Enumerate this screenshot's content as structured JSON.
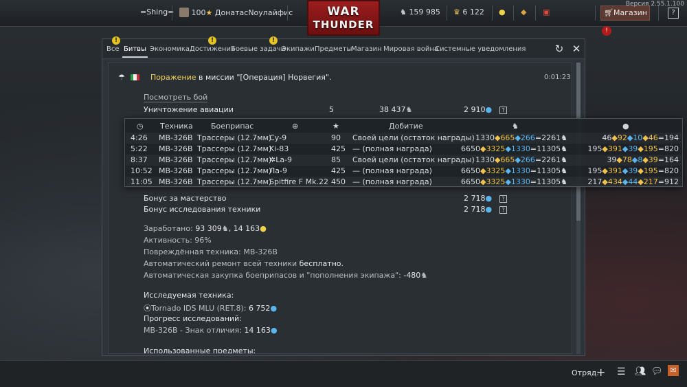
{
  "topbar": {
    "nickname": "=Shing=",
    "level": "100",
    "title": "ДонатасNоулайфис",
    "logo_line1": "WAR",
    "logo_line2": "THUNDER",
    "silver_lions": "159 985",
    "golden_eagles": "6 122",
    "shop_label": "Магазин",
    "version": "Версия 2.55.1.100",
    "help": "?"
  },
  "tabs": [
    "Все",
    "Битвы",
    "Экономика",
    "Достижения",
    "Боевые задачи",
    "Экипажи",
    "Предметы",
    "Магазин",
    "Мировая война",
    "Системные уведомления"
  ],
  "active_tab": "Битвы",
  "report": {
    "result": "Поражение",
    "mission_prefix": " в миссии \"[Операция] Норвегия\".",
    "time": "0:01:23",
    "view_battle": "Посмотреть бой",
    "aircraft_destroyed_label": "Уничтожение авиации",
    "aircraft_destroyed_count": "5",
    "aircraft_destroyed_sl": "38 437",
    "aircraft_destroyed_rp": "2 910",
    "mastery_label": "Бонус за мастерство",
    "mastery_rp": "2 718",
    "research_bonus_label": "Бонус исследования техники",
    "research_bonus_rp": "2 718",
    "earned_label": "Заработано:",
    "earned_sl": "93 309",
    "earned_rp": "14 163",
    "activity": "Активность: 96%",
    "damaged": "Повреждённая техника: MB-326B",
    "repair_prefix": "Автоматический ремонт всей техники ",
    "repair_value": "бесплатно.",
    "ammo_label": "Автоматическая закупка боеприпасов и \"пополнения экипажа\":",
    "ammo_value": "-480",
    "researched_label": "Исследуемая техника:",
    "researched_vehicle": "Tornado IDS MLU (RET.8):",
    "researched_value": "6 752",
    "progress_label": "Прогресс исследований:",
    "progress_vehicle": "MB-326B - Знак отличия:",
    "progress_value": "14 163",
    "used_items": "Использованные предметы:"
  },
  "kills_table": {
    "headers": [
      "Техника",
      "Боеприпас",
      "Добитие"
    ],
    "rows": [
      {
        "time": "4:26",
        "vehicle": "MB-326B",
        "ammo": "Трассеры (12.7мм)",
        "target": "Су-9",
        "points": "90",
        "finish": "Своей цели (остаток награды)",
        "sl_base": "1330",
        "sl_a": "665",
        "sl_b": "266",
        "sl_total": "=2261",
        "rp_base": "46",
        "rp_a": "92",
        "rp_b": "10",
        "rp_c": "46",
        "rp_total": "=194"
      },
      {
        "time": "5:22",
        "vehicle": "MB-326B",
        "ammo": "Трассеры (12.7мм)",
        "target": "Ki-83",
        "points": "425",
        "finish": "— (полная награда)",
        "sl_base": "6650",
        "sl_a": "3325",
        "sl_b": "1330",
        "sl_total": "=11305",
        "rp_base": "195",
        "rp_a": "391",
        "rp_b": "39",
        "rp_c": "195",
        "rp_total": "=820"
      },
      {
        "time": "8:37",
        "vehicle": "MB-326B",
        "ammo": "Трассеры (12.7мм)",
        "target": "✲La-9",
        "points": "85",
        "finish": "Своей цели (остаток награды)",
        "sl_base": "1330",
        "sl_a": "665",
        "sl_b": "266",
        "sl_total": "=2261",
        "rp_base": "39",
        "rp_a": "78",
        "rp_b": "8",
        "rp_c": "39",
        "rp_total": "=164"
      },
      {
        "time": "10:52",
        "vehicle": "MB-326B",
        "ammo": "Трассеры (12.7мм)",
        "target": "Ла-9",
        "points": "425",
        "finish": "— (полная награда)",
        "sl_base": "6650",
        "sl_a": "3325",
        "sl_b": "1330",
        "sl_total": "=11305",
        "rp_base": "195",
        "rp_a": "391",
        "rp_b": "39",
        "rp_c": "195",
        "rp_total": "=820"
      },
      {
        "time": "11:05",
        "vehicle": "MB-326B",
        "ammo": "Трассеры (12.7мм)",
        "target": "Spitfire F Mk.22",
        "points": "450",
        "finish": "— (полная награда)",
        "sl_base": "6650",
        "sl_a": "3325",
        "sl_b": "1330",
        "sl_total": "=11305",
        "rp_base": "217",
        "rp_a": "434",
        "rp_b": "44",
        "rp_c": "217",
        "rp_total": "=912"
      }
    ]
  },
  "bottombar": {
    "squad_label": "Отряд:"
  },
  "colors": {
    "defeat": "#f2d35b",
    "gold": "#f0c24d",
    "blue": "#5ab4ee",
    "shop": "#5a3a32",
    "logo": "#9c1d1d"
  }
}
